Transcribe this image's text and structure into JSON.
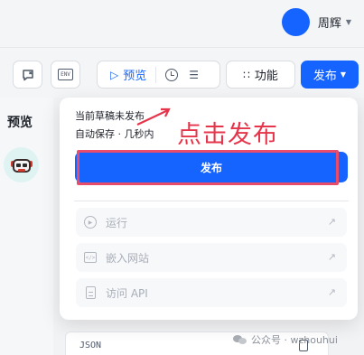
{
  "header": {
    "user_name": "周辉",
    "avatar_color": "#1664ff"
  },
  "toolbar": {
    "prompt_diff_icon": "chat-x-icon",
    "env_label": "ENV",
    "preview_label": "预览",
    "function_label": "功能",
    "publish_label": "发布",
    "accent_color": "#1664ff"
  },
  "left_panel": {
    "title": "预览",
    "bot_avatar": "robot-avatar"
  },
  "publish_dropdown": {
    "status": "当前草稿未发布",
    "autosave": "自动保存 · 几秒内",
    "publish_button_label": "发布",
    "options": [
      {
        "label": "运行",
        "icon": "play-circle-icon"
      },
      {
        "label": "嵌入网站",
        "icon": "embed-code-icon"
      },
      {
        "label": "访问 API",
        "icon": "document-icon"
      }
    ]
  },
  "annotation": {
    "text": "点击发布",
    "color": "#e5354b"
  },
  "main": {
    "json_label": "JSON"
  },
  "watermark": {
    "text": "公众号 · wzhouhui"
  }
}
